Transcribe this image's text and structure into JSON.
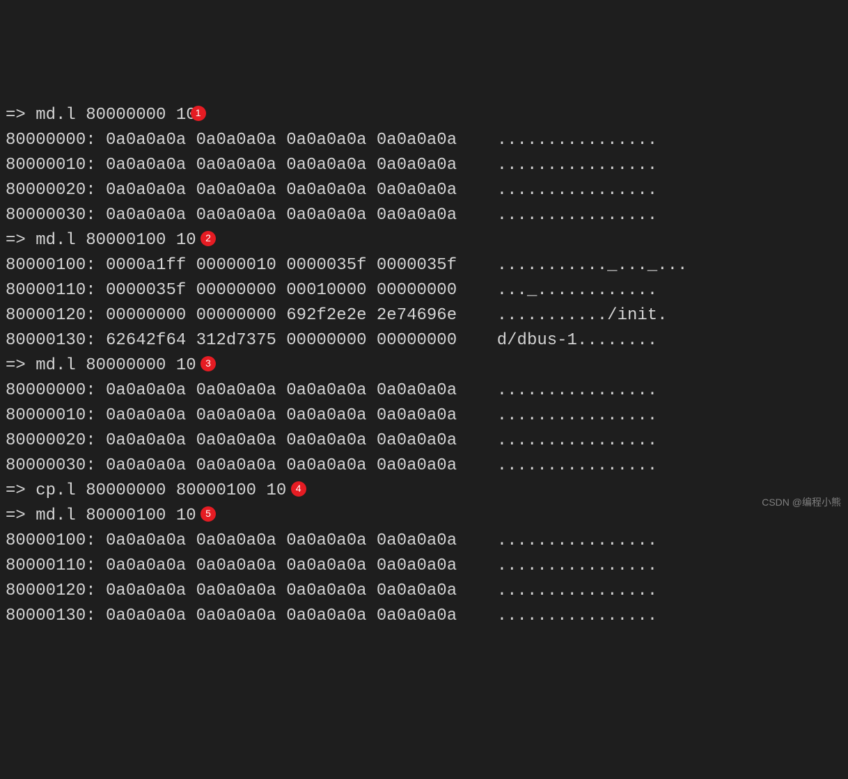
{
  "blocks": [
    {
      "prompt": "=> md.l 80000000 10",
      "badge": "1",
      "lines": [
        {
          "addr": "80000000:",
          "hex": "0a0a0a0a 0a0a0a0a 0a0a0a0a 0a0a0a0a",
          "ascii": "................"
        },
        {
          "addr": "80000010:",
          "hex": "0a0a0a0a 0a0a0a0a 0a0a0a0a 0a0a0a0a",
          "ascii": "................"
        },
        {
          "addr": "80000020:",
          "hex": "0a0a0a0a 0a0a0a0a 0a0a0a0a 0a0a0a0a",
          "ascii": "................"
        },
        {
          "addr": "80000030:",
          "hex": "0a0a0a0a 0a0a0a0a 0a0a0a0a 0a0a0a0a",
          "ascii": "................"
        }
      ]
    },
    {
      "prompt": "=> md.l 80000100 10 ",
      "badge": "2",
      "lines": [
        {
          "addr": "80000100:",
          "hex": "0000a1ff 00000010 0000035f 0000035f",
          "ascii": "..........._..._..."
        },
        {
          "addr": "80000110:",
          "hex": "0000035f 00000000 00010000 00000000",
          "ascii": "..._............"
        },
        {
          "addr": "80000120:",
          "hex": "00000000 00000000 692f2e2e 2e74696e",
          "ascii": ".........../init."
        },
        {
          "addr": "80000130:",
          "hex": "62642f64 312d7375 00000000 00000000",
          "ascii": "d/dbus-1........"
        }
      ]
    },
    {
      "prompt": "=> md.l 80000000 10 ",
      "badge": "3",
      "lines": [
        {
          "addr": "80000000:",
          "hex": "0a0a0a0a 0a0a0a0a 0a0a0a0a 0a0a0a0a",
          "ascii": "................"
        },
        {
          "addr": "80000010:",
          "hex": "0a0a0a0a 0a0a0a0a 0a0a0a0a 0a0a0a0a",
          "ascii": "................"
        },
        {
          "addr": "80000020:",
          "hex": "0a0a0a0a 0a0a0a0a 0a0a0a0a 0a0a0a0a",
          "ascii": "................"
        },
        {
          "addr": "80000030:",
          "hex": "0a0a0a0a 0a0a0a0a 0a0a0a0a 0a0a0a0a",
          "ascii": "................"
        }
      ]
    },
    {
      "prompt": "=> cp.l 80000000 80000100 10 ",
      "badge": "4",
      "lines": []
    },
    {
      "prompt": "=> md.l 80000100 10 ",
      "badge": "5",
      "lines": [
        {
          "addr": "80000100:",
          "hex": "0a0a0a0a 0a0a0a0a 0a0a0a0a 0a0a0a0a",
          "ascii": "................"
        },
        {
          "addr": "80000110:",
          "hex": "0a0a0a0a 0a0a0a0a 0a0a0a0a 0a0a0a0a",
          "ascii": "................"
        },
        {
          "addr": "80000120:",
          "hex": "0a0a0a0a 0a0a0a0a 0a0a0a0a 0a0a0a0a",
          "ascii": "................"
        },
        {
          "addr": "80000130:",
          "hex": "0a0a0a0a 0a0a0a0a 0a0a0a0a 0a0a0a0a",
          "ascii": "................"
        }
      ]
    }
  ],
  "watermark": "CSDN @编程小熊"
}
